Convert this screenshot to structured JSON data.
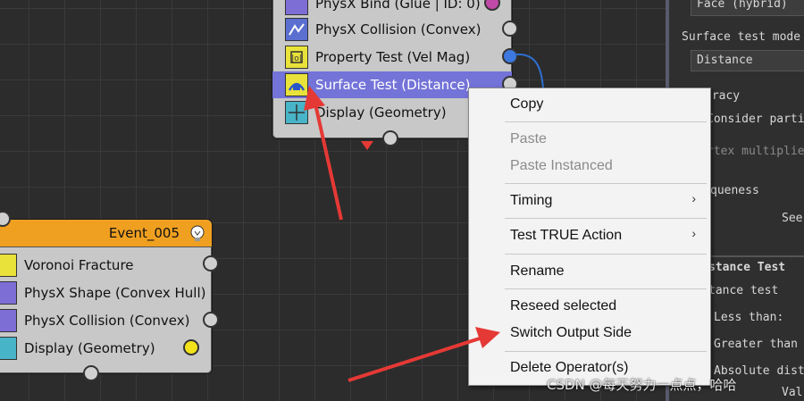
{
  "node_top": {
    "rows": [
      {
        "label": "PhysX Bind (Glue | ID: 0)",
        "icon": "physx-bind-icon"
      },
      {
        "label": "PhysX Collision (Convex)",
        "icon": "physx-collision-icon"
      },
      {
        "label": "Property Test (Vel Mag)",
        "icon": "property-test-icon"
      },
      {
        "label": "Surface Test (Distance)",
        "icon": "surface-test-icon"
      },
      {
        "label": "Display (Geometry)",
        "icon": "display-icon"
      }
    ]
  },
  "node_event": {
    "title": "Event_005",
    "rows": [
      {
        "label": "Voronoi Fracture",
        "icon": "voronoi-icon"
      },
      {
        "label": "PhysX Shape (Convex Hull)",
        "icon": "physx-shape-icon"
      },
      {
        "label": "PhysX Collision (Convex)",
        "icon": "physx-collision-icon"
      },
      {
        "label": "Display (Geometry)",
        "icon": "display-icon"
      }
    ]
  },
  "context_menu": {
    "copy": "Copy",
    "paste": "Paste",
    "paste_instanced": "Paste Instanced",
    "timing": "Timing",
    "test_true_action": "Test TRUE Action",
    "rename": "Rename",
    "reseed_selected": "Reseed selected",
    "switch_output_side": "Switch Output Side",
    "delete_operator": "Delete Operator(s)",
    "submenu_arrow": "›"
  },
  "panel": {
    "face_value": "Face (hybrid)",
    "surface_test_mode_label": "Surface test mode",
    "surface_test_mode_value": "Distance",
    "accuracy": "uracy",
    "consider": "Consider parti",
    "vertex": "rtex multiplie",
    "uniqueness": "queness",
    "see": "See",
    "distance_test_header": "stance Test",
    "distance_test": "tance test",
    "less_than": "Less than:",
    "greater_than": "Greater than",
    "absolute": "Absolute dist",
    "tail": "Val"
  },
  "watermark": "CSDN @每天努力一点点，哈哈",
  "colors": {
    "selected_row": "#7373d8",
    "event_header": "#f0a020",
    "annotation_arrow": "#e53935",
    "link_wire": "#2f6fd1"
  }
}
